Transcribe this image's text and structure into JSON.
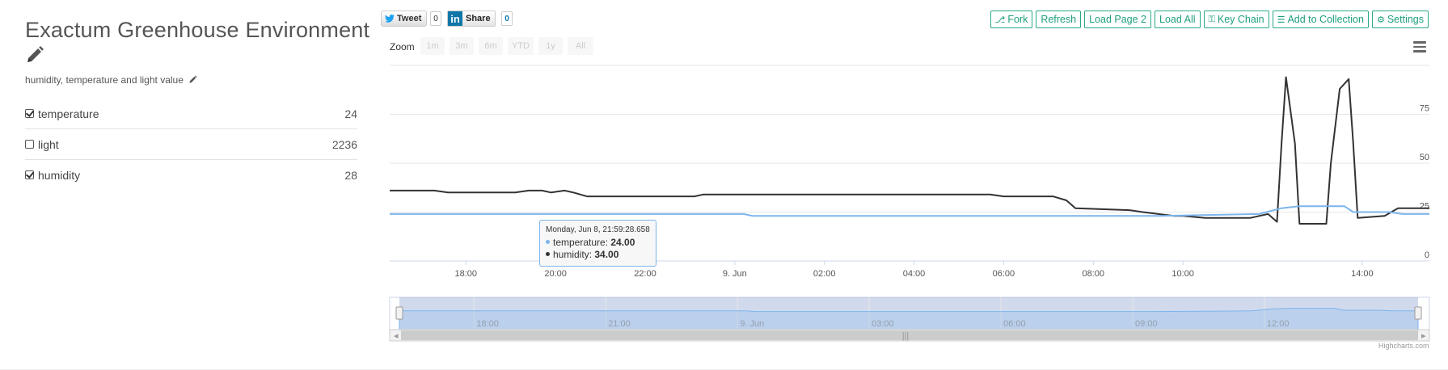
{
  "page": {
    "title": "Exactum Greenhouse Environment",
    "description": "humidity, temperature and light value"
  },
  "fields": [
    {
      "name": "temperature",
      "checked": true,
      "value": "24"
    },
    {
      "name": "light",
      "checked": false,
      "value": "2236"
    },
    {
      "name": "humidity",
      "checked": true,
      "value": "28"
    }
  ],
  "share": {
    "tweet_label": "Tweet",
    "tweet_count": "0",
    "linkedin_logo": "in",
    "linkedin_label": "Share",
    "linkedin_count": "0"
  },
  "toolbar": [
    {
      "label": "Fork",
      "icon": "fork-icon"
    },
    {
      "label": "Refresh",
      "icon": ""
    },
    {
      "label": "Load Page 2",
      "icon": ""
    },
    {
      "label": "Load All",
      "icon": ""
    },
    {
      "label": "Key Chain",
      "icon": "key-icon"
    },
    {
      "label": "Add to Collection",
      "icon": "database-icon"
    },
    {
      "label": "Settings",
      "icon": "gear-icon"
    }
  ],
  "zoom": {
    "label": "Zoom",
    "options": [
      "1m",
      "3m",
      "6m",
      "YTD",
      "1y",
      "All"
    ]
  },
  "tooltip": {
    "date": "Monday, Jun 8, 21:59:28.658",
    "rows": [
      {
        "name": "temperature",
        "value": "24.00",
        "color": "#7cb5ec"
      },
      {
        "name": "humidity",
        "value": "34.00",
        "color": "#333333"
      }
    ]
  },
  "credits": "Highcharts.com",
  "chart_data": {
    "type": "line",
    "x_ticks": [
      "18:00",
      "20:00",
      "22:00",
      "9. Jun",
      "02:00",
      "04:00",
      "06:00",
      "08:00",
      "10:00",
      "14:00"
    ],
    "y_ticks": [
      "0",
      "25",
      "50",
      "75"
    ],
    "ylim": [
      0,
      100
    ],
    "navigator_ticks": [
      "18:00",
      "21:00",
      "9. Jun",
      "03:00",
      "06:00",
      "09:00",
      "12:00"
    ],
    "series": [
      {
        "name": "temperature",
        "color": "#7cb5ec",
        "points": [
          [
            16.3,
            24
          ],
          [
            24.2,
            24
          ],
          [
            24.4,
            23
          ],
          [
            32.0,
            23
          ],
          [
            33.5,
            23
          ],
          [
            35.7,
            24
          ],
          [
            36.2,
            27
          ],
          [
            36.6,
            28
          ],
          [
            37.6,
            28
          ],
          [
            37.8,
            25
          ],
          [
            38.6,
            25
          ],
          [
            38.9,
            24
          ],
          [
            39.5,
            24
          ]
        ]
      },
      {
        "name": "humidity",
        "color": "#333333",
        "points": [
          [
            16.3,
            36
          ],
          [
            17.3,
            36
          ],
          [
            17.6,
            35
          ],
          [
            19.1,
            35
          ],
          [
            19.4,
            36
          ],
          [
            19.7,
            36
          ],
          [
            19.9,
            35
          ],
          [
            20.2,
            36
          ],
          [
            20.4,
            35
          ],
          [
            20.7,
            33
          ],
          [
            23.1,
            33
          ],
          [
            23.3,
            34
          ],
          [
            29.7,
            34
          ],
          [
            30.0,
            33
          ],
          [
            31.1,
            33
          ],
          [
            31.4,
            31
          ],
          [
            31.6,
            27
          ],
          [
            32.8,
            26
          ],
          [
            33.1,
            25
          ],
          [
            33.8,
            23
          ],
          [
            34.0,
            23
          ],
          [
            34.5,
            22
          ],
          [
            35.5,
            22
          ],
          [
            35.9,
            24
          ],
          [
            36.1,
            20
          ],
          [
            36.2,
            60
          ],
          [
            36.3,
            94
          ],
          [
            36.5,
            60
          ],
          [
            36.6,
            19
          ],
          [
            37.2,
            19
          ],
          [
            37.3,
            50
          ],
          [
            37.5,
            88
          ],
          [
            37.7,
            93
          ],
          [
            37.8,
            60
          ],
          [
            37.9,
            22
          ],
          [
            38.5,
            23
          ],
          [
            38.8,
            27
          ],
          [
            39.5,
            27
          ]
        ]
      }
    ]
  }
}
